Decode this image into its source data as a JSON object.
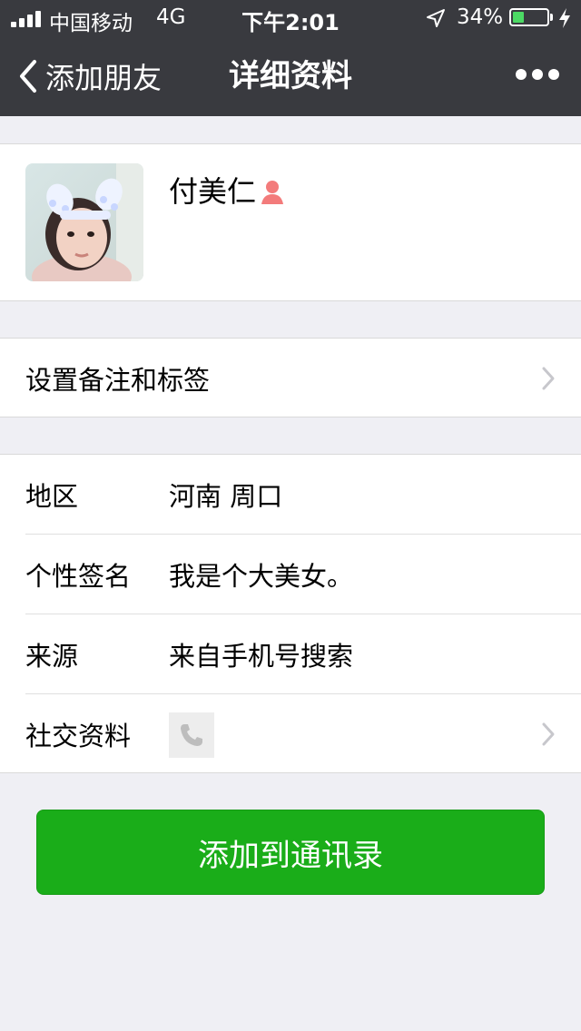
{
  "status_bar": {
    "carrier": "中国移动",
    "network": "4G",
    "time": "下午2:01",
    "battery_percent": "34%",
    "battery_level": 0.34
  },
  "nav": {
    "back_label": "添加朋友",
    "title": "详细资料",
    "more_icon": "more-dots-icon"
  },
  "profile": {
    "name": "付美仁",
    "gender_icon": "female-icon"
  },
  "remark_row": {
    "label": "设置备注和标签"
  },
  "info_rows": [
    {
      "label": "地区",
      "value": "河南 周口"
    },
    {
      "label": "个性签名",
      "value": "我是个大美女。"
    },
    {
      "label": "来源",
      "value": "来自手机号搜索"
    },
    {
      "label": "社交资料",
      "icon": "phone-icon"
    }
  ],
  "add_button": {
    "label": "添加到通讯录"
  },
  "colors": {
    "nav_bg": "#393a3f",
    "page_bg": "#efeff4",
    "primary_green": "#1aad19",
    "battery_green": "#4cd964",
    "female_icon": "#f37b7b"
  }
}
